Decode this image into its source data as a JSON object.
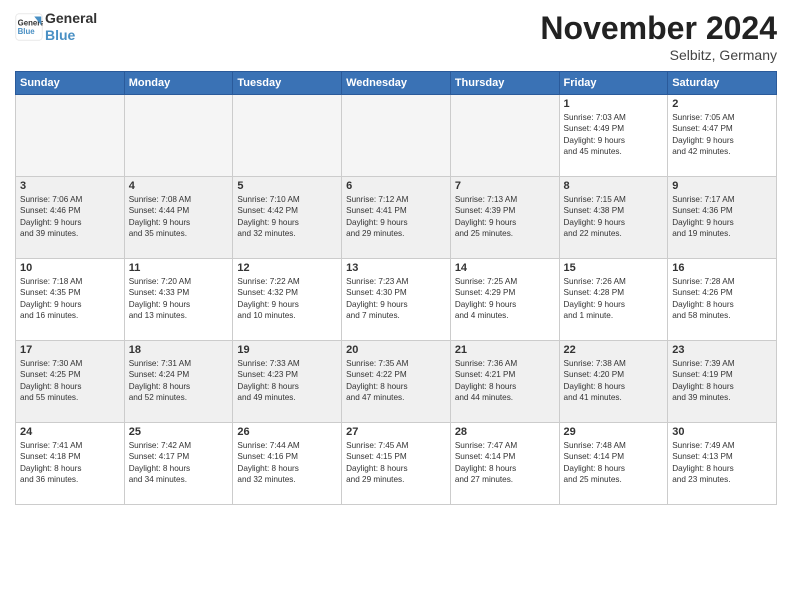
{
  "logo": {
    "line1": "General",
    "line2": "Blue"
  },
  "title": "November 2024",
  "location": "Selbitz, Germany",
  "days_header": [
    "Sunday",
    "Monday",
    "Tuesday",
    "Wednesday",
    "Thursday",
    "Friday",
    "Saturday"
  ],
  "weeks": [
    [
      {
        "day": "",
        "info": ""
      },
      {
        "day": "",
        "info": ""
      },
      {
        "day": "",
        "info": ""
      },
      {
        "day": "",
        "info": ""
      },
      {
        "day": "",
        "info": ""
      },
      {
        "day": "1",
        "info": "Sunrise: 7:03 AM\nSunset: 4:49 PM\nDaylight: 9 hours\nand 45 minutes."
      },
      {
        "day": "2",
        "info": "Sunrise: 7:05 AM\nSunset: 4:47 PM\nDaylight: 9 hours\nand 42 minutes."
      }
    ],
    [
      {
        "day": "3",
        "info": "Sunrise: 7:06 AM\nSunset: 4:46 PM\nDaylight: 9 hours\nand 39 minutes."
      },
      {
        "day": "4",
        "info": "Sunrise: 7:08 AM\nSunset: 4:44 PM\nDaylight: 9 hours\nand 35 minutes."
      },
      {
        "day": "5",
        "info": "Sunrise: 7:10 AM\nSunset: 4:42 PM\nDaylight: 9 hours\nand 32 minutes."
      },
      {
        "day": "6",
        "info": "Sunrise: 7:12 AM\nSunset: 4:41 PM\nDaylight: 9 hours\nand 29 minutes."
      },
      {
        "day": "7",
        "info": "Sunrise: 7:13 AM\nSunset: 4:39 PM\nDaylight: 9 hours\nand 25 minutes."
      },
      {
        "day": "8",
        "info": "Sunrise: 7:15 AM\nSunset: 4:38 PM\nDaylight: 9 hours\nand 22 minutes."
      },
      {
        "day": "9",
        "info": "Sunrise: 7:17 AM\nSunset: 4:36 PM\nDaylight: 9 hours\nand 19 minutes."
      }
    ],
    [
      {
        "day": "10",
        "info": "Sunrise: 7:18 AM\nSunset: 4:35 PM\nDaylight: 9 hours\nand 16 minutes."
      },
      {
        "day": "11",
        "info": "Sunrise: 7:20 AM\nSunset: 4:33 PM\nDaylight: 9 hours\nand 13 minutes."
      },
      {
        "day": "12",
        "info": "Sunrise: 7:22 AM\nSunset: 4:32 PM\nDaylight: 9 hours\nand 10 minutes."
      },
      {
        "day": "13",
        "info": "Sunrise: 7:23 AM\nSunset: 4:30 PM\nDaylight: 9 hours\nand 7 minutes."
      },
      {
        "day": "14",
        "info": "Sunrise: 7:25 AM\nSunset: 4:29 PM\nDaylight: 9 hours\nand 4 minutes."
      },
      {
        "day": "15",
        "info": "Sunrise: 7:26 AM\nSunset: 4:28 PM\nDaylight: 9 hours\nand 1 minute."
      },
      {
        "day": "16",
        "info": "Sunrise: 7:28 AM\nSunset: 4:26 PM\nDaylight: 8 hours\nand 58 minutes."
      }
    ],
    [
      {
        "day": "17",
        "info": "Sunrise: 7:30 AM\nSunset: 4:25 PM\nDaylight: 8 hours\nand 55 minutes."
      },
      {
        "day": "18",
        "info": "Sunrise: 7:31 AM\nSunset: 4:24 PM\nDaylight: 8 hours\nand 52 minutes."
      },
      {
        "day": "19",
        "info": "Sunrise: 7:33 AM\nSunset: 4:23 PM\nDaylight: 8 hours\nand 49 minutes."
      },
      {
        "day": "20",
        "info": "Sunrise: 7:35 AM\nSunset: 4:22 PM\nDaylight: 8 hours\nand 47 minutes."
      },
      {
        "day": "21",
        "info": "Sunrise: 7:36 AM\nSunset: 4:21 PM\nDaylight: 8 hours\nand 44 minutes."
      },
      {
        "day": "22",
        "info": "Sunrise: 7:38 AM\nSunset: 4:20 PM\nDaylight: 8 hours\nand 41 minutes."
      },
      {
        "day": "23",
        "info": "Sunrise: 7:39 AM\nSunset: 4:19 PM\nDaylight: 8 hours\nand 39 minutes."
      }
    ],
    [
      {
        "day": "24",
        "info": "Sunrise: 7:41 AM\nSunset: 4:18 PM\nDaylight: 8 hours\nand 36 minutes."
      },
      {
        "day": "25",
        "info": "Sunrise: 7:42 AM\nSunset: 4:17 PM\nDaylight: 8 hours\nand 34 minutes."
      },
      {
        "day": "26",
        "info": "Sunrise: 7:44 AM\nSunset: 4:16 PM\nDaylight: 8 hours\nand 32 minutes."
      },
      {
        "day": "27",
        "info": "Sunrise: 7:45 AM\nSunset: 4:15 PM\nDaylight: 8 hours\nand 29 minutes."
      },
      {
        "day": "28",
        "info": "Sunrise: 7:47 AM\nSunset: 4:14 PM\nDaylight: 8 hours\nand 27 minutes."
      },
      {
        "day": "29",
        "info": "Sunrise: 7:48 AM\nSunset: 4:14 PM\nDaylight: 8 hours\nand 25 minutes."
      },
      {
        "day": "30",
        "info": "Sunrise: 7:49 AM\nSunset: 4:13 PM\nDaylight: 8 hours\nand 23 minutes."
      }
    ]
  ]
}
